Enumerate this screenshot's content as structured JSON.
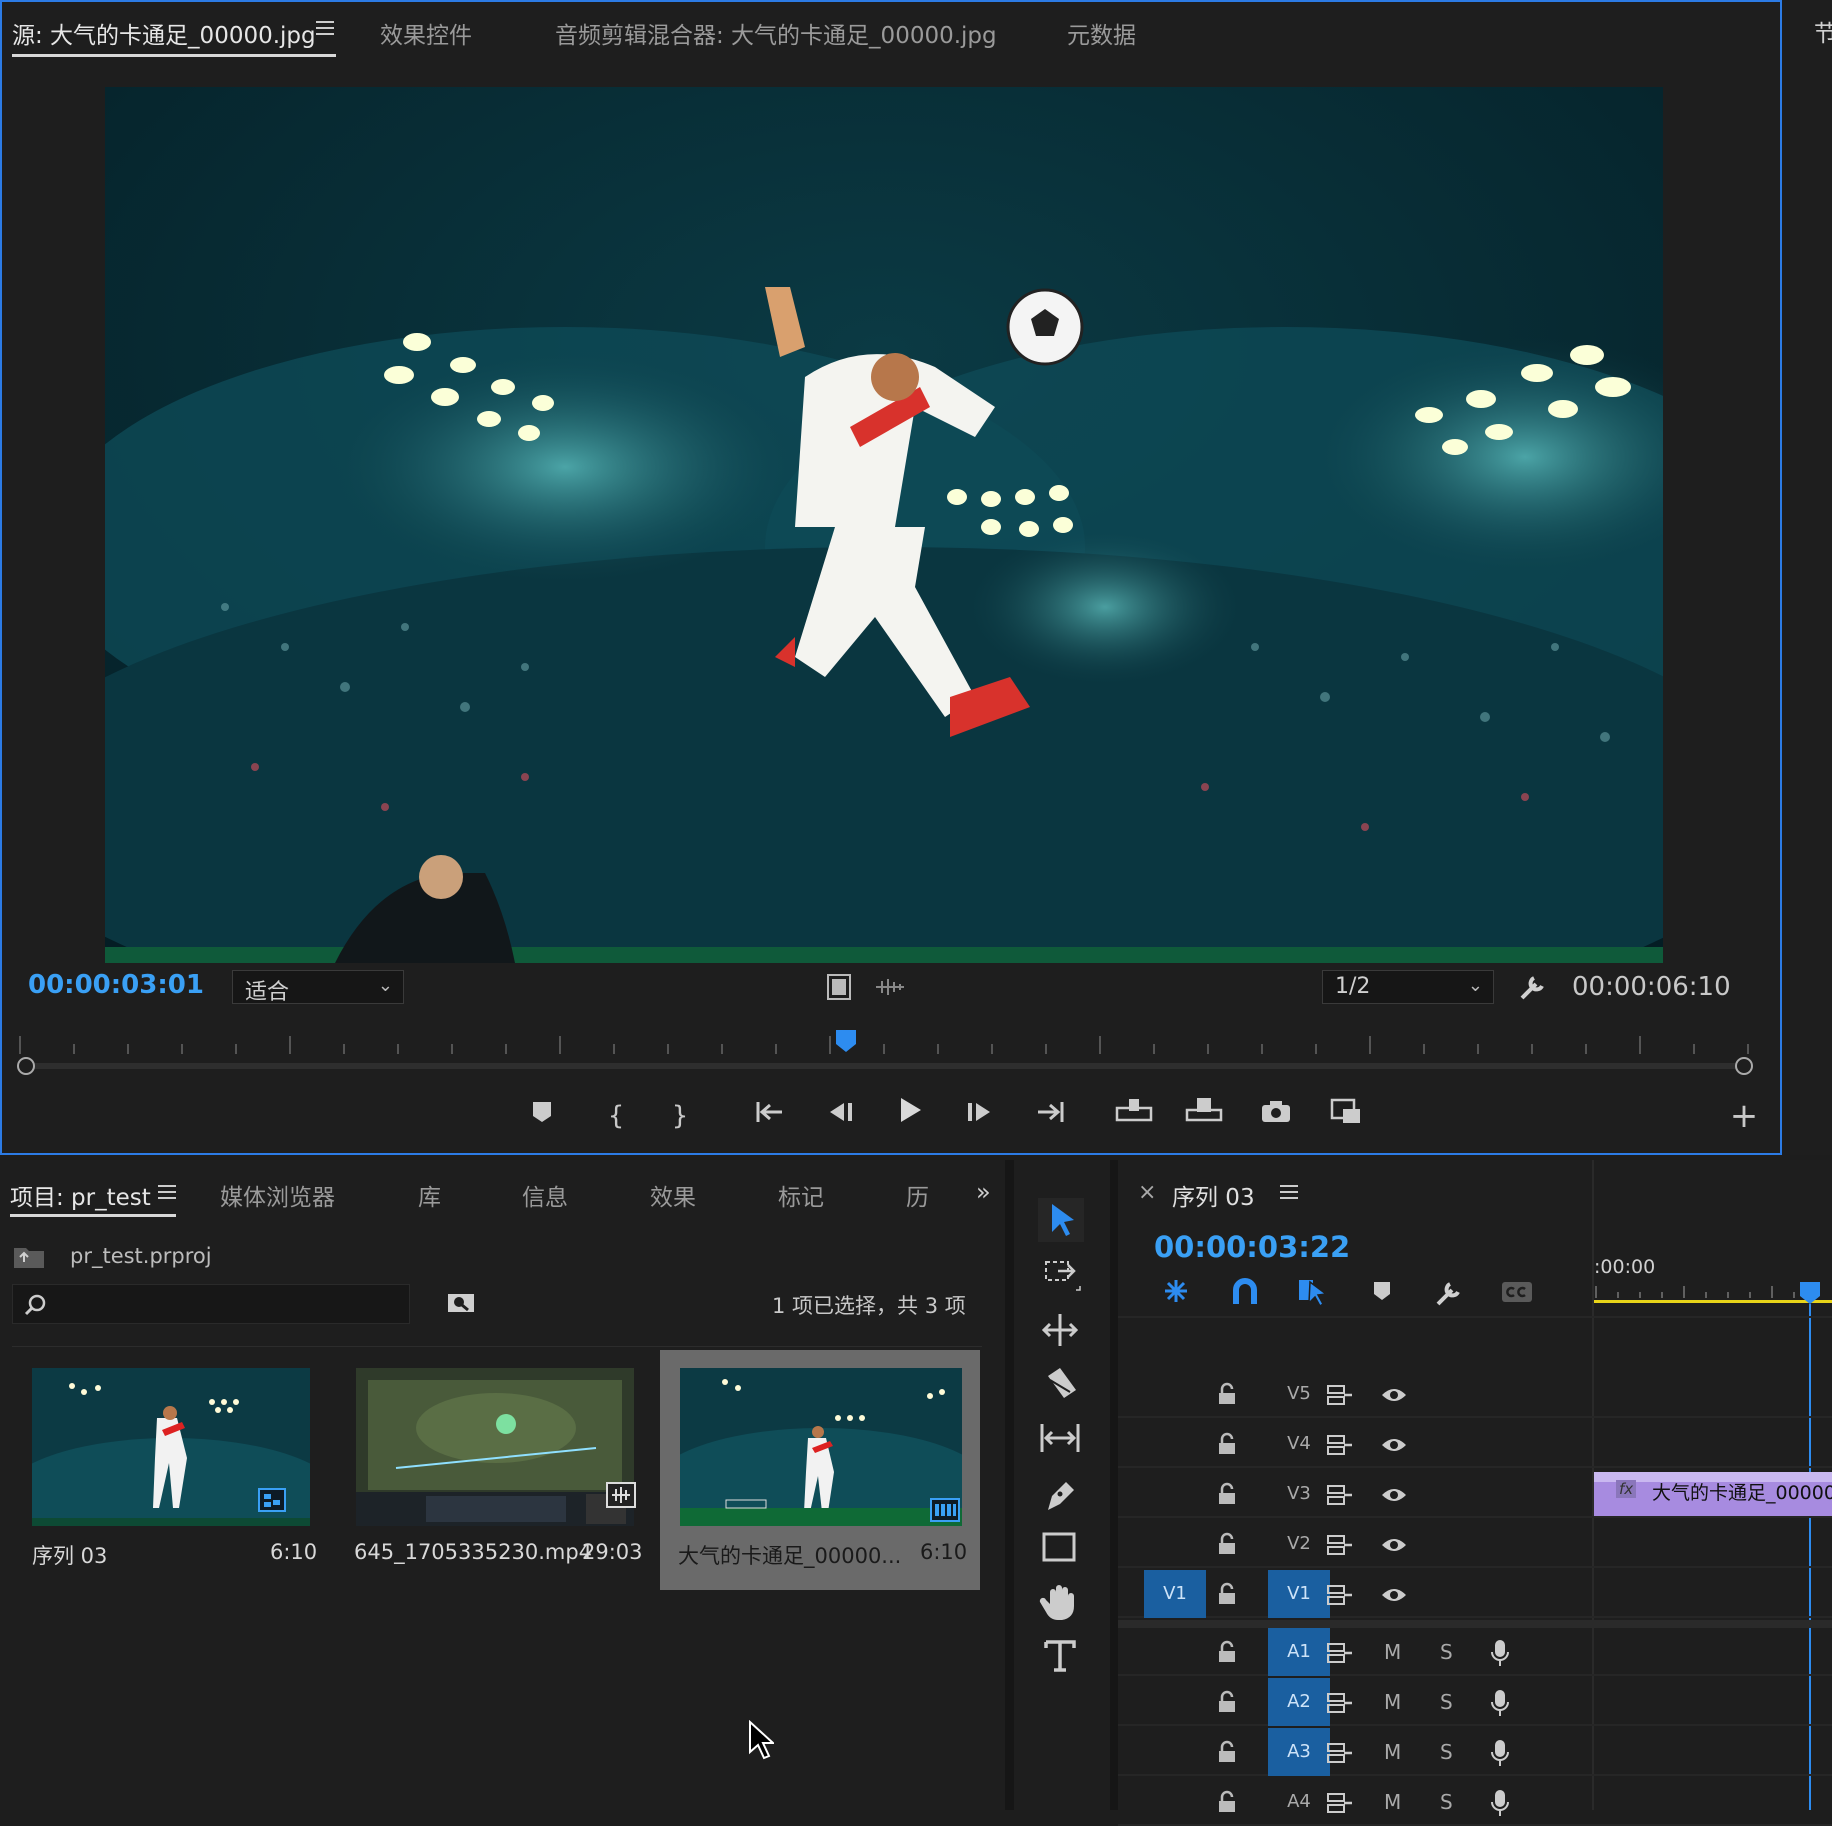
{
  "source_monitor": {
    "tabs": [
      {
        "label": "源: 大气的卡通足_00000.jpg",
        "active": true
      },
      {
        "label": "效果控件",
        "active": false
      },
      {
        "label": "音频剪辑混合器: 大气的卡通足_00000.jpg",
        "active": false
      },
      {
        "label": "元数据",
        "active": false
      }
    ],
    "right_edge_tab": "节",
    "current_timecode": "00:00:03:01",
    "zoom_select": "适合",
    "resolution_select": "1/2",
    "duration_timecode": "00:00:06:10",
    "playhead_fraction": 0.48
  },
  "project_panel": {
    "tabs": [
      {
        "label": "项目: pr_test",
        "active": true
      },
      {
        "label": "媒体浏览器",
        "active": false
      },
      {
        "label": "库",
        "active": false
      },
      {
        "label": "信息",
        "active": false
      },
      {
        "label": "效果",
        "active": false
      },
      {
        "label": "标记",
        "active": false
      },
      {
        "label": "历",
        "active": false
      }
    ],
    "overflow_icon": "double-chevron-right-icon",
    "project_file": "pr_test.prproj",
    "search_placeholder": "",
    "selection_status": "1 项已选择，共 3 项",
    "items": [
      {
        "name": "序列 03",
        "duration": "6:10",
        "badge": "sequence-icon",
        "selected": false
      },
      {
        "name": "645_1705335230.mp4",
        "duration": "29:03",
        "badge": "video-audio-icon",
        "selected": false
      },
      {
        "name": "大气的卡通足_00000...",
        "duration": "6:10",
        "badge": "image-sequence-icon",
        "selected": true
      }
    ]
  },
  "timeline": {
    "sequence_title": "序列 03",
    "timecode": "00:00:03:22",
    "ruler_start": ":00:00",
    "source_patch_v": "V1",
    "video_tracks": [
      "V5",
      "V4",
      "V3",
      "V2",
      "V1"
    ],
    "audio_tracks": [
      "A1",
      "A2",
      "A3",
      "A4"
    ],
    "mute_label": "M",
    "solo_label": "S",
    "clip": {
      "track": "V3",
      "label": "大气的卡通足_00000",
      "fx": "fx"
    }
  },
  "colors": {
    "accent_blue": "#3aa0f5",
    "panel_border": "#2c7be5",
    "track_target": "#1a5fa0",
    "clip_purple": "#a78be0",
    "work_area": "#e8d419"
  }
}
